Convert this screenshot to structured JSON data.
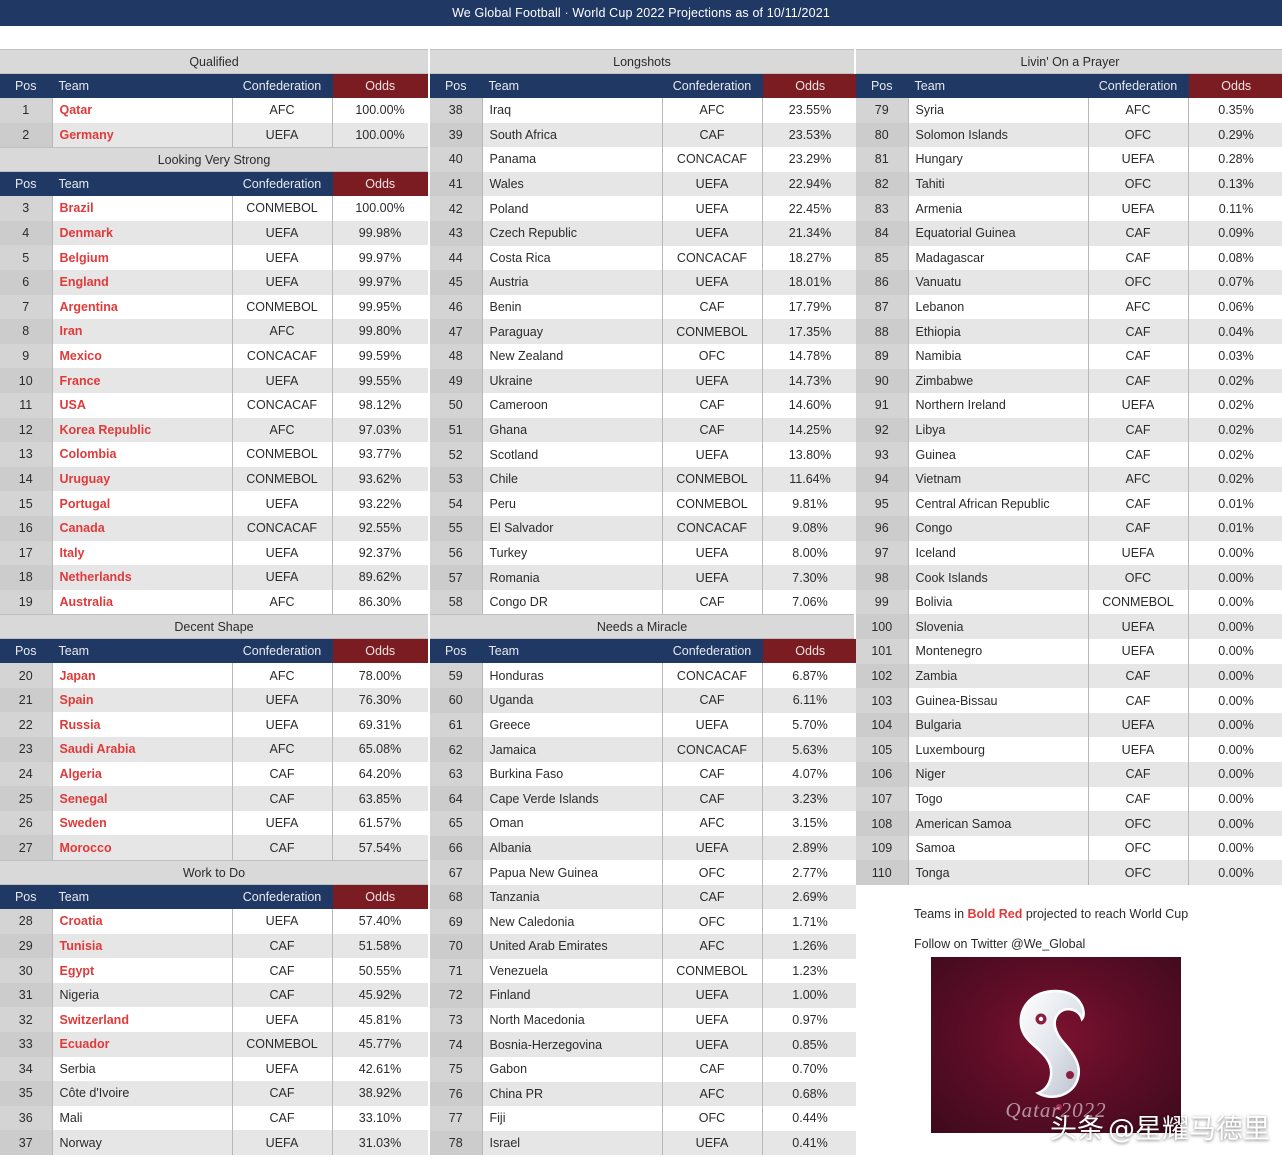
{
  "header": {
    "title": "We Global Football · World Cup 2022 Projections as of 10/11/2021"
  },
  "columns_headers": {
    "pos": "Pos",
    "team": "Team",
    "confederation": "Confederation",
    "odds": "Odds"
  },
  "legend": {
    "line1_pre": "Teams in ",
    "line1_bold": "Bold Red",
    "line1_post": " projected to reach World Cup",
    "line2": "Follow on Twitter @We_Global",
    "poster_word": "Qatar2022"
  },
  "watermark": {
    "prefix": "头条",
    "handle": "@星耀马德里"
  },
  "colors": {
    "header_blue": "#1f3864",
    "odds_header_red": "#7b1c22",
    "group_title_gray": "#d9d9d9",
    "bold_red": "#e03a3a"
  },
  "chart_data": {
    "type": "table",
    "title": "We Global Football · World Cup 2022 Projections as of 10/11/2021",
    "columns": [
      "Pos",
      "Team",
      "Confederation",
      "Odds"
    ],
    "note": "Teams in Bold Red projected to reach World Cup"
  },
  "groups": [
    {
      "id": "qualified",
      "column": 1,
      "title": "Qualified",
      "rows": [
        {
          "pos": "1",
          "team": "Qatar",
          "conf": "AFC",
          "odds": "100.00%",
          "red": true
        },
        {
          "pos": "2",
          "team": "Germany",
          "conf": "UEFA",
          "odds": "100.00%",
          "red": true
        }
      ]
    },
    {
      "id": "looking-very-strong",
      "column": 1,
      "title": "Looking Very Strong",
      "rows": [
        {
          "pos": "3",
          "team": "Brazil",
          "conf": "CONMEBOL",
          "odds": "100.00%",
          "red": true
        },
        {
          "pos": "4",
          "team": "Denmark",
          "conf": "UEFA",
          "odds": "99.98%",
          "red": true
        },
        {
          "pos": "5",
          "team": "Belgium",
          "conf": "UEFA",
          "odds": "99.97%",
          "red": true
        },
        {
          "pos": "6",
          "team": "England",
          "conf": "UEFA",
          "odds": "99.97%",
          "red": true
        },
        {
          "pos": "7",
          "team": "Argentina",
          "conf": "CONMEBOL",
          "odds": "99.95%",
          "red": true
        },
        {
          "pos": "8",
          "team": "Iran",
          "conf": "AFC",
          "odds": "99.80%",
          "red": true
        },
        {
          "pos": "9",
          "team": "Mexico",
          "conf": "CONCACAF",
          "odds": "99.59%",
          "red": true
        },
        {
          "pos": "10",
          "team": "France",
          "conf": "UEFA",
          "odds": "99.55%",
          "red": true
        },
        {
          "pos": "11",
          "team": "USA",
          "conf": "CONCACAF",
          "odds": "98.12%",
          "red": true
        },
        {
          "pos": "12",
          "team": "Korea Republic",
          "conf": "AFC",
          "odds": "97.03%",
          "red": true
        },
        {
          "pos": "13",
          "team": "Colombia",
          "conf": "CONMEBOL",
          "odds": "93.77%",
          "red": true
        },
        {
          "pos": "14",
          "team": "Uruguay",
          "conf": "CONMEBOL",
          "odds": "93.62%",
          "red": true
        },
        {
          "pos": "15",
          "team": "Portugal",
          "conf": "UEFA",
          "odds": "93.22%",
          "red": true
        },
        {
          "pos": "16",
          "team": "Canada",
          "conf": "CONCACAF",
          "odds": "92.55%",
          "red": true
        },
        {
          "pos": "17",
          "team": "Italy",
          "conf": "UEFA",
          "odds": "92.37%",
          "red": true
        },
        {
          "pos": "18",
          "team": "Netherlands",
          "conf": "UEFA",
          "odds": "89.62%",
          "red": true
        },
        {
          "pos": "19",
          "team": "Australia",
          "conf": "AFC",
          "odds": "86.30%",
          "red": true
        }
      ]
    },
    {
      "id": "decent-shape",
      "column": 1,
      "title": "Decent Shape",
      "rows": [
        {
          "pos": "20",
          "team": "Japan",
          "conf": "AFC",
          "odds": "78.00%",
          "red": true
        },
        {
          "pos": "21",
          "team": "Spain",
          "conf": "UEFA",
          "odds": "76.30%",
          "red": true
        },
        {
          "pos": "22",
          "team": "Russia",
          "conf": "UEFA",
          "odds": "69.31%",
          "red": true
        },
        {
          "pos": "23",
          "team": "Saudi Arabia",
          "conf": "AFC",
          "odds": "65.08%",
          "red": true
        },
        {
          "pos": "24",
          "team": "Algeria",
          "conf": "CAF",
          "odds": "64.20%",
          "red": true
        },
        {
          "pos": "25",
          "team": "Senegal",
          "conf": "CAF",
          "odds": "63.85%",
          "red": true
        },
        {
          "pos": "26",
          "team": "Sweden",
          "conf": "UEFA",
          "odds": "61.57%",
          "red": true
        },
        {
          "pos": "27",
          "team": "Morocco",
          "conf": "CAF",
          "odds": "57.54%",
          "red": true
        }
      ]
    },
    {
      "id": "work-to-do",
      "column": 1,
      "title": "Work to Do",
      "rows": [
        {
          "pos": "28",
          "team": "Croatia",
          "conf": "UEFA",
          "odds": "57.40%",
          "red": true
        },
        {
          "pos": "29",
          "team": "Tunisia",
          "conf": "CAF",
          "odds": "51.58%",
          "red": true
        },
        {
          "pos": "30",
          "team": "Egypt",
          "conf": "CAF",
          "odds": "50.55%",
          "red": true
        },
        {
          "pos": "31",
          "team": "Nigeria",
          "conf": "CAF",
          "odds": "45.92%",
          "red": false
        },
        {
          "pos": "32",
          "team": "Switzerland",
          "conf": "UEFA",
          "odds": "45.81%",
          "red": true
        },
        {
          "pos": "33",
          "team": "Ecuador",
          "conf": "CONMEBOL",
          "odds": "45.77%",
          "red": true
        },
        {
          "pos": "34",
          "team": "Serbia",
          "conf": "UEFA",
          "odds": "42.61%",
          "red": false
        },
        {
          "pos": "35",
          "team": "Côte d'Ivoire",
          "conf": "CAF",
          "odds": "38.92%",
          "red": false
        },
        {
          "pos": "36",
          "team": "Mali",
          "conf": "CAF",
          "odds": "33.10%",
          "red": false
        },
        {
          "pos": "37",
          "team": "Norway",
          "conf": "UEFA",
          "odds": "31.03%",
          "red": false
        }
      ]
    },
    {
      "id": "longshots",
      "column": 2,
      "title": "Longshots",
      "rows": [
        {
          "pos": "38",
          "team": "Iraq",
          "conf": "AFC",
          "odds": "23.55%",
          "red": false
        },
        {
          "pos": "39",
          "team": "South Africa",
          "conf": "CAF",
          "odds": "23.53%",
          "red": false
        },
        {
          "pos": "40",
          "team": "Panama",
          "conf": "CONCACAF",
          "odds": "23.29%",
          "red": false
        },
        {
          "pos": "41",
          "team": "Wales",
          "conf": "UEFA",
          "odds": "22.94%",
          "red": false
        },
        {
          "pos": "42",
          "team": "Poland",
          "conf": "UEFA",
          "odds": "22.45%",
          "red": false
        },
        {
          "pos": "43",
          "team": "Czech Republic",
          "conf": "UEFA",
          "odds": "21.34%",
          "red": false
        },
        {
          "pos": "44",
          "team": "Costa Rica",
          "conf": "CONCACAF",
          "odds": "18.27%",
          "red": false
        },
        {
          "pos": "45",
          "team": "Austria",
          "conf": "UEFA",
          "odds": "18.01%",
          "red": false
        },
        {
          "pos": "46",
          "team": "Benin",
          "conf": "CAF",
          "odds": "17.79%",
          "red": false
        },
        {
          "pos": "47",
          "team": "Paraguay",
          "conf": "CONMEBOL",
          "odds": "17.35%",
          "red": false
        },
        {
          "pos": "48",
          "team": "New Zealand",
          "conf": "OFC",
          "odds": "14.78%",
          "red": false
        },
        {
          "pos": "49",
          "team": "Ukraine",
          "conf": "UEFA",
          "odds": "14.73%",
          "red": false
        },
        {
          "pos": "50",
          "team": "Cameroon",
          "conf": "CAF",
          "odds": "14.60%",
          "red": false
        },
        {
          "pos": "51",
          "team": "Ghana",
          "conf": "CAF",
          "odds": "14.25%",
          "red": false
        },
        {
          "pos": "52",
          "team": "Scotland",
          "conf": "UEFA",
          "odds": "13.80%",
          "red": false
        },
        {
          "pos": "53",
          "team": "Chile",
          "conf": "CONMEBOL",
          "odds": "11.64%",
          "red": false
        },
        {
          "pos": "54",
          "team": "Peru",
          "conf": "CONMEBOL",
          "odds": "9.81%",
          "red": false
        },
        {
          "pos": "55",
          "team": "El Salvador",
          "conf": "CONCACAF",
          "odds": "9.08%",
          "red": false
        },
        {
          "pos": "56",
          "team": "Turkey",
          "conf": "UEFA",
          "odds": "8.00%",
          "red": false
        },
        {
          "pos": "57",
          "team": "Romania",
          "conf": "UEFA",
          "odds": "7.30%",
          "red": false
        },
        {
          "pos": "58",
          "team": "Congo DR",
          "conf": "CAF",
          "odds": "7.06%",
          "red": false
        }
      ]
    },
    {
      "id": "needs-a-miracle",
      "column": 2,
      "title": "Needs a Miracle",
      "rows": [
        {
          "pos": "59",
          "team": "Honduras",
          "conf": "CONCACAF",
          "odds": "6.87%",
          "red": false
        },
        {
          "pos": "60",
          "team": "Uganda",
          "conf": "CAF",
          "odds": "6.11%",
          "red": false
        },
        {
          "pos": "61",
          "team": "Greece",
          "conf": "UEFA",
          "odds": "5.70%",
          "red": false
        },
        {
          "pos": "62",
          "team": "Jamaica",
          "conf": "CONCACAF",
          "odds": "5.63%",
          "red": false
        },
        {
          "pos": "63",
          "team": "Burkina Faso",
          "conf": "CAF",
          "odds": "4.07%",
          "red": false
        },
        {
          "pos": "64",
          "team": "Cape Verde Islands",
          "conf": "CAF",
          "odds": "3.23%",
          "red": false
        },
        {
          "pos": "65",
          "team": "Oman",
          "conf": "AFC",
          "odds": "3.15%",
          "red": false
        },
        {
          "pos": "66",
          "team": "Albania",
          "conf": "UEFA",
          "odds": "2.89%",
          "red": false
        },
        {
          "pos": "67",
          "team": "Papua New Guinea",
          "conf": "OFC",
          "odds": "2.77%",
          "red": false
        },
        {
          "pos": "68",
          "team": "Tanzania",
          "conf": "CAF",
          "odds": "2.69%",
          "red": false
        },
        {
          "pos": "69",
          "team": "New Caledonia",
          "conf": "OFC",
          "odds": "1.71%",
          "red": false
        },
        {
          "pos": "70",
          "team": "United Arab Emirates",
          "conf": "AFC",
          "odds": "1.26%",
          "red": false
        },
        {
          "pos": "71",
          "team": "Venezuela",
          "conf": "CONMEBOL",
          "odds": "1.23%",
          "red": false
        },
        {
          "pos": "72",
          "team": "Finland",
          "conf": "UEFA",
          "odds": "1.00%",
          "red": false
        },
        {
          "pos": "73",
          "team": "North Macedonia",
          "conf": "UEFA",
          "odds": "0.97%",
          "red": false
        },
        {
          "pos": "74",
          "team": "Bosnia-Herzegovina",
          "conf": "UEFA",
          "odds": "0.85%",
          "red": false
        },
        {
          "pos": "75",
          "team": "Gabon",
          "conf": "CAF",
          "odds": "0.70%",
          "red": false
        },
        {
          "pos": "76",
          "team": "China PR",
          "conf": "AFC",
          "odds": "0.68%",
          "red": false
        },
        {
          "pos": "77",
          "team": "Fiji",
          "conf": "OFC",
          "odds": "0.44%",
          "red": false
        },
        {
          "pos": "78",
          "team": "Israel",
          "conf": "UEFA",
          "odds": "0.41%",
          "red": false
        }
      ]
    },
    {
      "id": "livin-on-a-prayer",
      "column": 3,
      "title": "Livin' On a Prayer",
      "rows": [
        {
          "pos": "79",
          "team": "Syria",
          "conf": "AFC",
          "odds": "0.35%",
          "red": false
        },
        {
          "pos": "80",
          "team": "Solomon Islands",
          "conf": "OFC",
          "odds": "0.29%",
          "red": false
        },
        {
          "pos": "81",
          "team": "Hungary",
          "conf": "UEFA",
          "odds": "0.28%",
          "red": false
        },
        {
          "pos": "82",
          "team": "Tahiti",
          "conf": "OFC",
          "odds": "0.13%",
          "red": false
        },
        {
          "pos": "83",
          "team": "Armenia",
          "conf": "UEFA",
          "odds": "0.11%",
          "red": false
        },
        {
          "pos": "84",
          "team": "Equatorial Guinea",
          "conf": "CAF",
          "odds": "0.09%",
          "red": false
        },
        {
          "pos": "85",
          "team": "Madagascar",
          "conf": "CAF",
          "odds": "0.08%",
          "red": false
        },
        {
          "pos": "86",
          "team": "Vanuatu",
          "conf": "OFC",
          "odds": "0.07%",
          "red": false
        },
        {
          "pos": "87",
          "team": "Lebanon",
          "conf": "AFC",
          "odds": "0.06%",
          "red": false
        },
        {
          "pos": "88",
          "team": "Ethiopia",
          "conf": "CAF",
          "odds": "0.04%",
          "red": false
        },
        {
          "pos": "89",
          "team": "Namibia",
          "conf": "CAF",
          "odds": "0.03%",
          "red": false
        },
        {
          "pos": "90",
          "team": "Zimbabwe",
          "conf": "CAF",
          "odds": "0.02%",
          "red": false
        },
        {
          "pos": "91",
          "team": "Northern Ireland",
          "conf": "UEFA",
          "odds": "0.02%",
          "red": false
        },
        {
          "pos": "92",
          "team": "Libya",
          "conf": "CAF",
          "odds": "0.02%",
          "red": false
        },
        {
          "pos": "93",
          "team": "Guinea",
          "conf": "CAF",
          "odds": "0.02%",
          "red": false
        },
        {
          "pos": "94",
          "team": "Vietnam",
          "conf": "AFC",
          "odds": "0.02%",
          "red": false
        },
        {
          "pos": "95",
          "team": "Central African Republic",
          "conf": "CAF",
          "odds": "0.01%",
          "red": false
        },
        {
          "pos": "96",
          "team": "Congo",
          "conf": "CAF",
          "odds": "0.01%",
          "red": false
        },
        {
          "pos": "97",
          "team": "Iceland",
          "conf": "UEFA",
          "odds": "0.00%",
          "red": false
        },
        {
          "pos": "98",
          "team": "Cook Islands",
          "conf": "OFC",
          "odds": "0.00%",
          "red": false
        },
        {
          "pos": "99",
          "team": "Bolivia",
          "conf": "CONMEBOL",
          "odds": "0.00%",
          "red": false
        },
        {
          "pos": "100",
          "team": "Slovenia",
          "conf": "UEFA",
          "odds": "0.00%",
          "red": false
        },
        {
          "pos": "101",
          "team": "Montenegro",
          "conf": "UEFA",
          "odds": "0.00%",
          "red": false
        },
        {
          "pos": "102",
          "team": "Zambia",
          "conf": "CAF",
          "odds": "0.00%",
          "red": false
        },
        {
          "pos": "103",
          "team": "Guinea-Bissau",
          "conf": "CAF",
          "odds": "0.00%",
          "red": false
        },
        {
          "pos": "104",
          "team": "Bulgaria",
          "conf": "UEFA",
          "odds": "0.00%",
          "red": false
        },
        {
          "pos": "105",
          "team": "Luxembourg",
          "conf": "UEFA",
          "odds": "0.00%",
          "red": false
        },
        {
          "pos": "106",
          "team": "Niger",
          "conf": "CAF",
          "odds": "0.00%",
          "red": false
        },
        {
          "pos": "107",
          "team": "Togo",
          "conf": "CAF",
          "odds": "0.00%",
          "red": false
        },
        {
          "pos": "108",
          "team": "American Samoa",
          "conf": "OFC",
          "odds": "0.00%",
          "red": false
        },
        {
          "pos": "109",
          "team": "Samoa",
          "conf": "OFC",
          "odds": "0.00%",
          "red": false
        },
        {
          "pos": "110",
          "team": "Tonga",
          "conf": "OFC",
          "odds": "0.00%",
          "red": false
        }
      ]
    }
  ]
}
